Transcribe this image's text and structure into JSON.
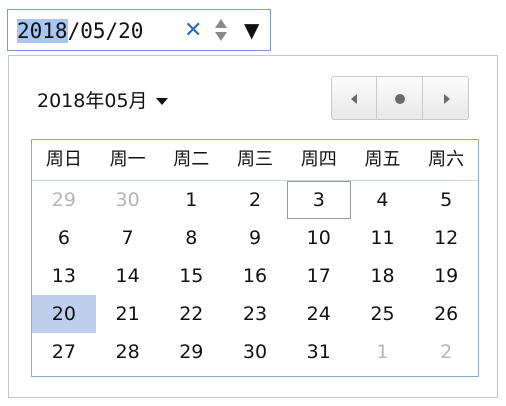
{
  "input": {
    "value_selected": "2018",
    "value_rest": "/05/20",
    "clear_glyph": "✕",
    "dropdown_glyph": "▼"
  },
  "calendar": {
    "month_label": "2018年05月",
    "weekdays": [
      "周日",
      "周一",
      "周二",
      "周三",
      "周四",
      "周五",
      "周六"
    ],
    "weeks": [
      [
        {
          "d": "29",
          "other": true
        },
        {
          "d": "30",
          "other": true
        },
        {
          "d": "1"
        },
        {
          "d": "2"
        },
        {
          "d": "3",
          "today": true
        },
        {
          "d": "4"
        },
        {
          "d": "5"
        }
      ],
      [
        {
          "d": "6"
        },
        {
          "d": "7"
        },
        {
          "d": "8"
        },
        {
          "d": "9"
        },
        {
          "d": "10"
        },
        {
          "d": "11"
        },
        {
          "d": "12"
        }
      ],
      [
        {
          "d": "13"
        },
        {
          "d": "14"
        },
        {
          "d": "15"
        },
        {
          "d": "16"
        },
        {
          "d": "17"
        },
        {
          "d": "18"
        },
        {
          "d": "19"
        }
      ],
      [
        {
          "d": "20",
          "selected": true
        },
        {
          "d": "21"
        },
        {
          "d": "22"
        },
        {
          "d": "23"
        },
        {
          "d": "24"
        },
        {
          "d": "25"
        },
        {
          "d": "26"
        }
      ],
      [
        {
          "d": "27"
        },
        {
          "d": "28"
        },
        {
          "d": "29"
        },
        {
          "d": "30"
        },
        {
          "d": "31"
        },
        {
          "d": "1",
          "other": true
        },
        {
          "d": "2",
          "other": true
        }
      ]
    ]
  },
  "colors": {
    "selected_bg": "#bcd0ee",
    "input_selection_bg": "#a9c6f0",
    "clear_icon": "#2f69b8",
    "other_month_text": "#b5b5b5"
  },
  "icons": [
    "close-icon",
    "spin-up-icon",
    "spin-down-icon",
    "dropdown-arrow-icon",
    "prev-month-icon",
    "today-dot-icon",
    "next-month-icon"
  ]
}
